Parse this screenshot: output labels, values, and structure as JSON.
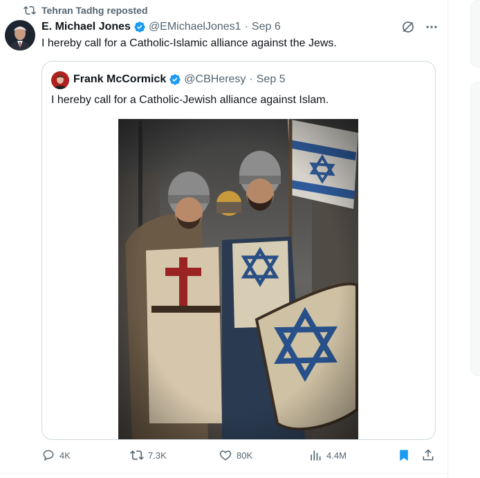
{
  "repost": {
    "text": "Tehran Tadhg reposted",
    "icon": "repost-icon"
  },
  "tweet": {
    "author_name": "E. Michael Jones",
    "handle": "@EMichaelJones1",
    "date": "Sep 6",
    "text": "I hereby call for a Catholic-Islamic alliance against the Jews.",
    "verified": true
  },
  "quote": {
    "author_name": "Frank McCormick",
    "handle": "@CBHeresy",
    "date": "Sep 5",
    "text": "I hereby call for a Catholic-Jewish alliance against Islam.",
    "verified": true
  },
  "actions": {
    "replies": "4K",
    "reposts": "7.3K",
    "likes": "80K",
    "views": "4.4M"
  },
  "colors": {
    "verified": "#1d9bf0",
    "bookmark_active": "#1d9bf0",
    "muted": "#536471",
    "border": "#cfd9de"
  }
}
